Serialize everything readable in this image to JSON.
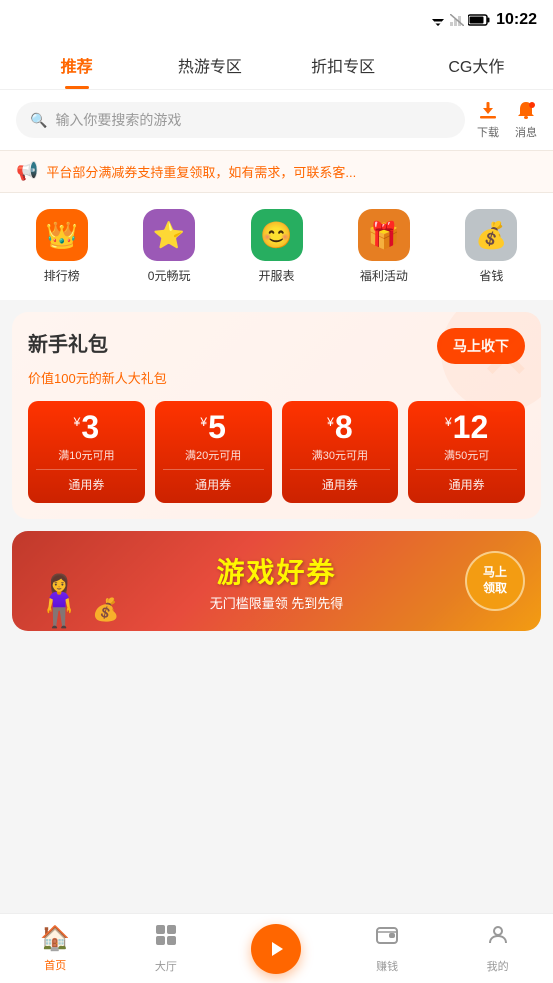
{
  "statusBar": {
    "time": "10:22"
  },
  "navTabs": {
    "items": [
      {
        "label": "推荐",
        "active": true
      },
      {
        "label": "热游专区",
        "active": false
      },
      {
        "label": "折扣专区",
        "active": false
      },
      {
        "label": "CG大作",
        "active": false
      }
    ]
  },
  "search": {
    "placeholder": "输入你要搜索的游戏"
  },
  "headerButtons": {
    "download": "下载",
    "message": "消息"
  },
  "notice": {
    "text": "平台部分满减券支持重复领取，如有需求，可联系客..."
  },
  "iconGrid": {
    "items": [
      {
        "label": "排行榜",
        "colorClass": "orange",
        "icon": "👑"
      },
      {
        "label": "0元畅玩",
        "colorClass": "purple",
        "icon": "⭐"
      },
      {
        "label": "开服表",
        "colorClass": "green",
        "icon": "😊"
      },
      {
        "label": "福利活动",
        "colorClass": "orange2",
        "icon": "🎁"
      },
      {
        "label": "省钱",
        "colorClass": "gray",
        "icon": "💰"
      }
    ]
  },
  "giftPackage": {
    "title": "新手礼包",
    "subtitle": "价值100元的新人大礼包",
    "claimButton": "马上收下",
    "coupons": [
      {
        "amount": "3",
        "condition": "满10元可用",
        "type": "通用券"
      },
      {
        "amount": "5",
        "condition": "满20元可用",
        "type": "通用券"
      },
      {
        "amount": "8",
        "condition": "满30元可用",
        "type": "通用券"
      },
      {
        "amount": "12",
        "condition": "满50元可",
        "type": "通用券"
      }
    ]
  },
  "gameCouponBanner": {
    "title": "游戏好券",
    "subtitle": "无门槛限量领 先到先得",
    "claimButton": "马上\n领取"
  },
  "bottomNav": {
    "items": [
      {
        "label": "首页",
        "icon": "🏠",
        "active": true
      },
      {
        "label": "大厅",
        "icon": "⊞",
        "active": false
      },
      {
        "label": "",
        "center": true
      },
      {
        "label": "赚钱",
        "icon": "💳",
        "active": false
      },
      {
        "label": "我的",
        "icon": "😊",
        "active": false
      }
    ]
  }
}
